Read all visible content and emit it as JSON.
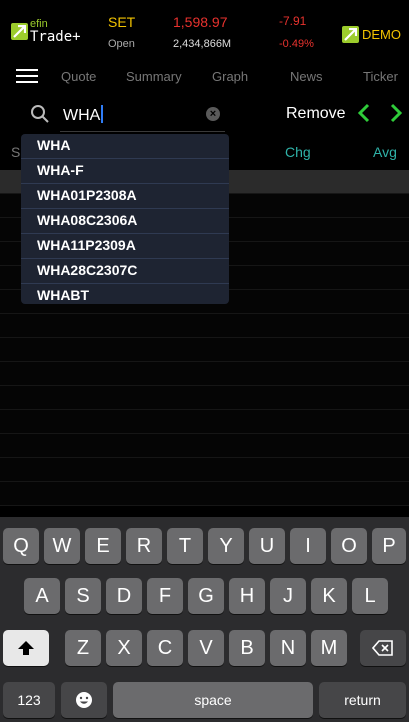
{
  "header": {
    "logo_efin": "efin",
    "logo_trade": "Trade+",
    "index_name": "SET",
    "index_status": "Open",
    "index_value": "1,598.97",
    "index_volume": "2,434,866M",
    "index_change": "-7.91",
    "index_change_pct": "-0.49%",
    "demo_label": "DEMO",
    "colors": {
      "brand_green": "#9ccc2c",
      "gold": "#f2c300",
      "down_red": "#e8322e"
    }
  },
  "nav": {
    "tabs": [
      "Quote",
      "Summary",
      "Graph",
      "News",
      "Ticker"
    ]
  },
  "search": {
    "value": "WHA",
    "remove_label": "Remove"
  },
  "table": {
    "col_s": "S",
    "col_chg": "Chg",
    "col_avg": "Avg"
  },
  "dropdown": {
    "items": [
      "WHA",
      "WHA-F",
      "WHA01P2308A",
      "WHA08C2306A",
      "WHA11P2309A",
      "WHA28C2307C",
      "WHABT"
    ]
  },
  "keyboard": {
    "row1": [
      "Q",
      "W",
      "E",
      "R",
      "T",
      "Y",
      "U",
      "I",
      "O",
      "P"
    ],
    "row2": [
      "A",
      "S",
      "D",
      "F",
      "G",
      "H",
      "J",
      "K",
      "L"
    ],
    "row3": [
      "Z",
      "X",
      "C",
      "V",
      "B",
      "N",
      "M"
    ],
    "numbers_label": "123",
    "space_label": "space",
    "return_label": "return"
  }
}
